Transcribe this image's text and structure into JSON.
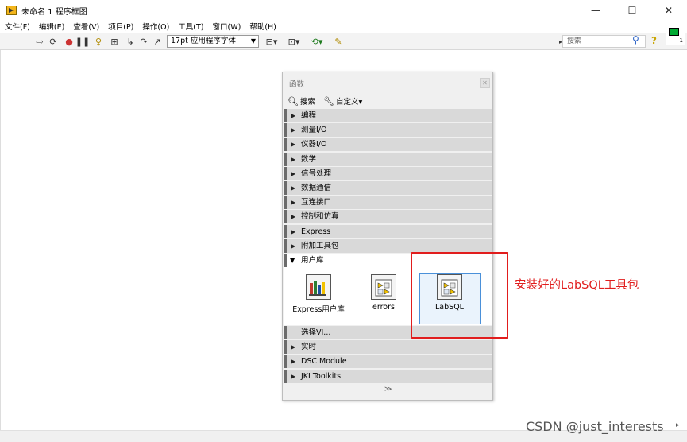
{
  "window": {
    "title": "未命名 1 程序框图",
    "minimize": "—",
    "maximize": "☐",
    "close": "✕"
  },
  "menu": [
    "文件(F)",
    "编辑(E)",
    "查看(V)",
    "项目(P)",
    "操作(O)",
    "工具(T)",
    "窗口(W)",
    "帮助(H)"
  ],
  "toolbar": {
    "font_select": "17pt 应用程序字体",
    "search_placeholder": "搜索",
    "help": "?",
    "vi_icon_number": "1"
  },
  "palette": {
    "title": "函数",
    "search_label": "搜索",
    "customize_label": "自定义▾",
    "categories": [
      "编程",
      "测量I/O",
      "仪器I/O",
      "数学",
      "信号处理",
      "数据通信",
      "互连接口",
      "控制和仿真",
      "Express",
      "附加工具包"
    ],
    "open_category": "用户库",
    "library_items": [
      "Express用户库",
      "errors",
      "LabSQL"
    ],
    "categories_after": [
      "选择VI...",
      "实时",
      "DSC Module",
      "JKI Toolkits"
    ],
    "more_arrow": "≫"
  },
  "annotation": {
    "text": "安装好的LabSQL工具包",
    "color": "#e11d1d"
  },
  "watermark": "CSDN @just_interests"
}
